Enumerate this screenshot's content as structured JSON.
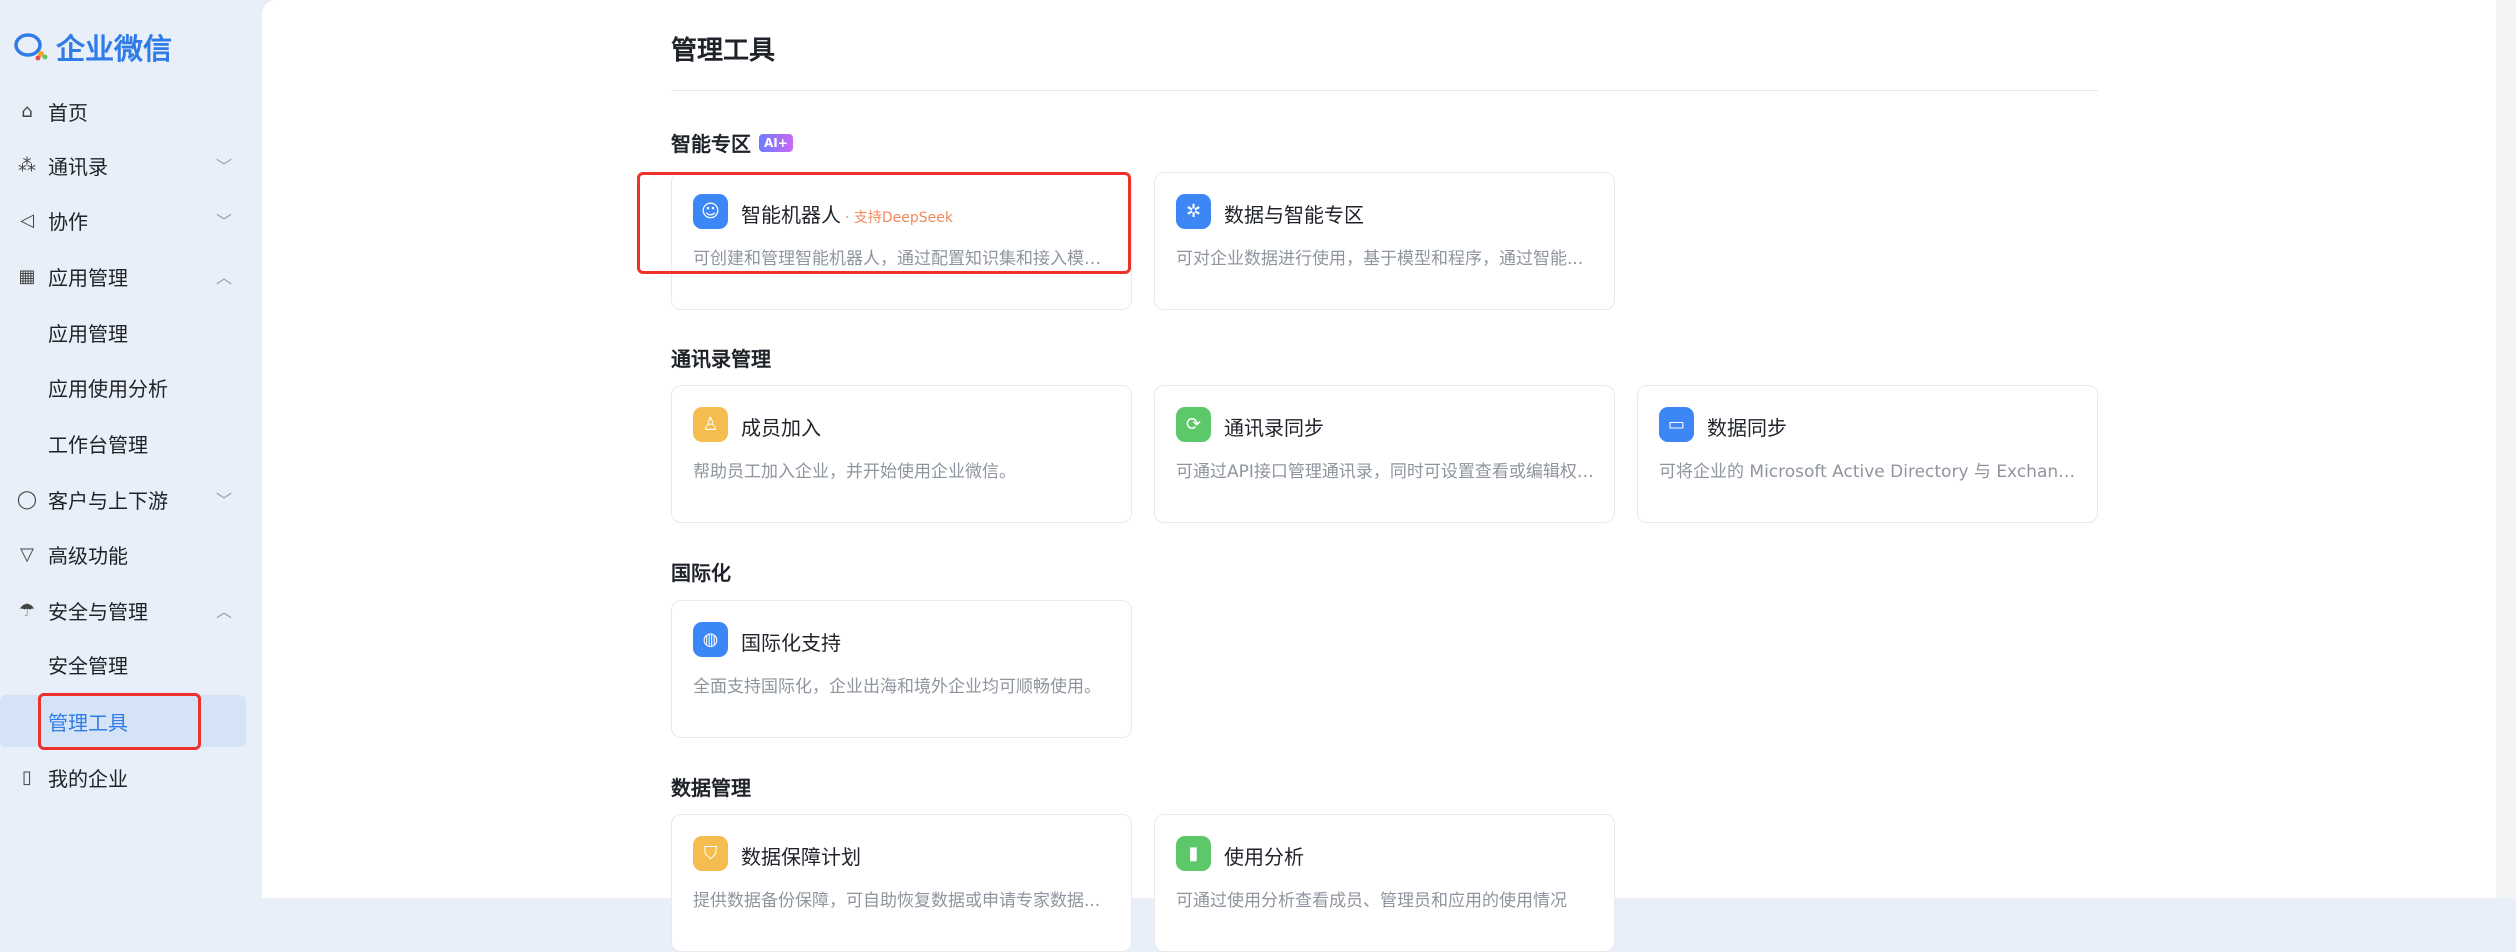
{
  "app": {
    "title": "企业微信"
  },
  "sidebar": {
    "items": [
      {
        "label": "首页",
        "icon": "home-icon"
      },
      {
        "label": "通讯录",
        "icon": "org-chart-icon",
        "chevron": "down"
      },
      {
        "label": "协作",
        "icon": "collab-icon",
        "chevron": "down"
      },
      {
        "label": "应用管理",
        "icon": "apps-grid-icon",
        "chevron": "up"
      },
      {
        "label": "应用管理",
        "sub": true
      },
      {
        "label": "应用使用分析",
        "sub": true
      },
      {
        "label": "工作台管理",
        "sub": true
      },
      {
        "label": "客户与上下游",
        "icon": "chat-bubble-icon",
        "chevron": "down"
      },
      {
        "label": "高级功能",
        "icon": "badge-icon"
      },
      {
        "label": "安全与管理",
        "icon": "umbrella-icon",
        "chevron": "up"
      },
      {
        "label": "安全管理",
        "sub": true
      },
      {
        "label": "管理工具",
        "sub": true,
        "active": true
      },
      {
        "label": "我的企业",
        "icon": "building-icon"
      }
    ]
  },
  "main": {
    "title": "管理工具",
    "sections": [
      {
        "title": "智能专区",
        "badge": "AI+",
        "cards": [
          {
            "title": "智能机器人",
            "tag": "· 支持DeepSeek",
            "desc": "可创建和管理智能机器人，通过配置知识集和接入模型...",
            "color": "#3d86f5"
          },
          {
            "title": "数据与智能专区",
            "desc": "可对企业数据进行使用，基于模型和程序，通过智能...",
            "color": "#3d86f5"
          }
        ]
      },
      {
        "title": "通讯录管理",
        "cards": [
          {
            "title": "成员加入",
            "desc": "帮助员工加入企业，并开始使用企业微信。",
            "color": "#f5bd4f"
          },
          {
            "title": "通讯录同步",
            "desc": "可通过API接口管理通讯录，同时可设置查看或编辑权限...",
            "color": "#5cc86a"
          },
          {
            "title": "数据同步",
            "desc": "可将企业的 Microsoft Active Directory 与 Exchange...",
            "color": "#3d86f5"
          }
        ]
      },
      {
        "title": "国际化",
        "cards": [
          {
            "title": "国际化支持",
            "desc": "全面支持国际化，企业出海和境外企业均可顺畅使用。",
            "color": "#3d86f5"
          }
        ]
      },
      {
        "title": "数据管理",
        "cards": [
          {
            "title": "数据保障计划",
            "desc": "提供数据备份保障，可自助恢复数据或申请专家数据...",
            "color": "#f5bd4f"
          },
          {
            "title": "使用分析",
            "desc": "可通过使用分析查看成员、管理员和应用的使用情况",
            "color": "#5cc86a"
          }
        ]
      }
    ]
  }
}
